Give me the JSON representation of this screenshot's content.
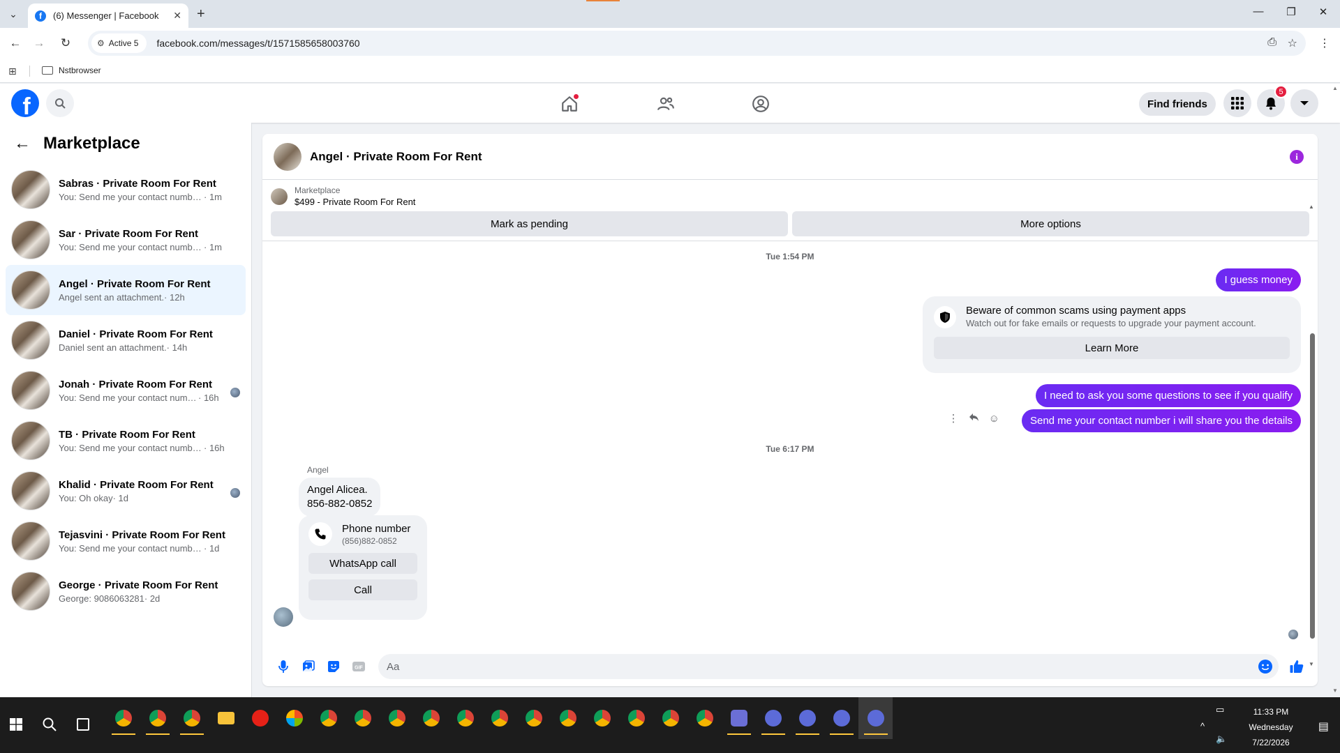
{
  "browser": {
    "tab_title": "(6) Messenger | Facebook",
    "tab_favicon": "f",
    "new_tab": "+",
    "active_label": "Active 5",
    "url": "facebook.com/messages/t/1571585658003760",
    "bookmark_folder": "Nstbrowser"
  },
  "header": {
    "find_friends": "Find friends",
    "notifications_count": "5",
    "logo": "f",
    "brand_color": "#0866ff"
  },
  "sidebar": {
    "title": "Marketplace",
    "conversations": [
      {
        "name": "Sabras · Private Room For Rent",
        "snippet": "You: Send me your contact number i will share you the details",
        "time": "· 1m"
      },
      {
        "name": "Sar · Private Room For Rent",
        "snippet": "You: Send me your contact number i will share you the details",
        "time": "· 1m"
      },
      {
        "name": "Angel · Private Room For Rent",
        "snippet": "Angel sent an attachment.",
        "time": "· 12h"
      },
      {
        "name": "Daniel · Private Room For Rent",
        "snippet": "Daniel sent an attachment.",
        "time": "· 14h"
      },
      {
        "name": "Jonah · Private Room For Rent",
        "snippet": "You: Send me your contact number i will share you the details",
        "time": "· 16h"
      },
      {
        "name": "TB · Private Room For Rent",
        "snippet": "You: Send me your contact number i will share you the details",
        "time": "· 16h"
      },
      {
        "name": "Khalid · Private Room For Rent",
        "snippet": "You: Oh okay",
        "time": "· 1d"
      },
      {
        "name": "Tejasvini · Private Room For Rent",
        "snippet": "You: Send me your contact number i will share you the details",
        "time": "· 1d"
      },
      {
        "name": "George · Private Room For Rent",
        "snippet": "George: 9086063281",
        "time": "· 2d"
      }
    ]
  },
  "chat": {
    "title": "Angel · Private Room For Rent",
    "marketplace_label": "Marketplace",
    "listing": "$499 - Private Room For Rent",
    "mark_pending": "Mark as pending",
    "more_options": "More options",
    "time1": "Tue 1:54 PM",
    "msg1": "I guess money",
    "scam_title": "Beware of common scams using payment apps",
    "scam_desc": "Watch out for fake emails or requests to upgrade your payment account.",
    "learn_more": "Learn More",
    "msg2": "I need to ask you some questions to see if you qualify",
    "msg3": "Send me your contact number i will share you the details",
    "time2": "Tue 6:17 PM",
    "sender": "Angel",
    "in_line1": "Angel Alicea.",
    "in_line2": "856-882-0852",
    "phone_label": "Phone number",
    "phone_value": "(856)882-0852",
    "whatsapp_call": "WhatsApp call",
    "call": "Call",
    "composer_placeholder": "Aa",
    "accent_color": "#7b17f5"
  },
  "taskbar": {
    "time": "11:33 PM",
    "day": "Wednesday",
    "date": "7/22/2026"
  }
}
